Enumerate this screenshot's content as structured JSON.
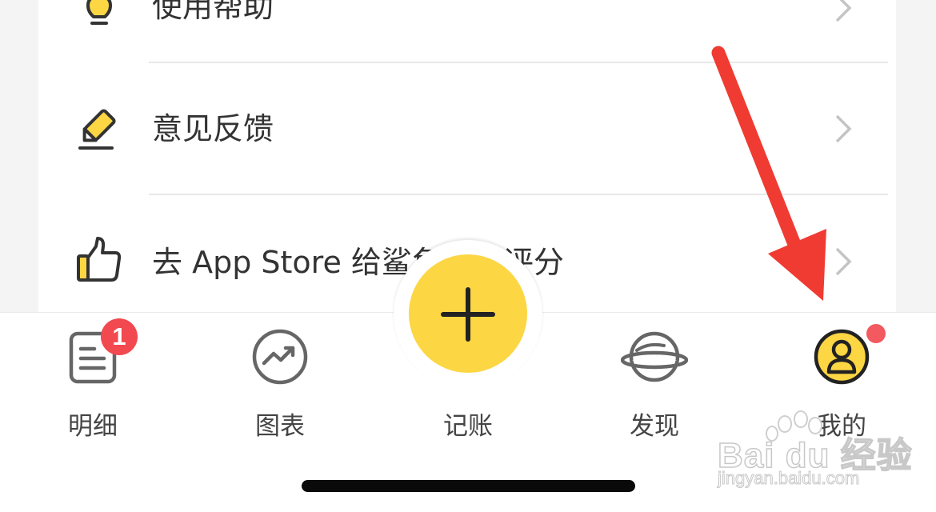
{
  "menu": {
    "items": [
      {
        "label": "使用帮助",
        "icon": "lightbulb-icon"
      },
      {
        "label": "意见反馈",
        "icon": "pencil-icon"
      },
      {
        "label": "去 App Store 给鲨鱼记账评分",
        "icon": "thumbs-up-icon"
      }
    ]
  },
  "tabbar": {
    "tabs": [
      {
        "label": "明细",
        "icon": "list-icon",
        "badge": "1"
      },
      {
        "label": "图表",
        "icon": "trend-chart-icon"
      },
      {
        "label": "记账",
        "icon": "plus-icon"
      },
      {
        "label": "发现",
        "icon": "planet-icon"
      },
      {
        "label": "我的",
        "icon": "profile-icon",
        "has_dot": true
      }
    ]
  },
  "watermark": {
    "brand": "Bai du 经验",
    "url": "jingyan.baidu.com"
  },
  "colors": {
    "accent": "#fcd643",
    "badge": "#f2484f",
    "annotation_arrow": "#f03b32"
  }
}
